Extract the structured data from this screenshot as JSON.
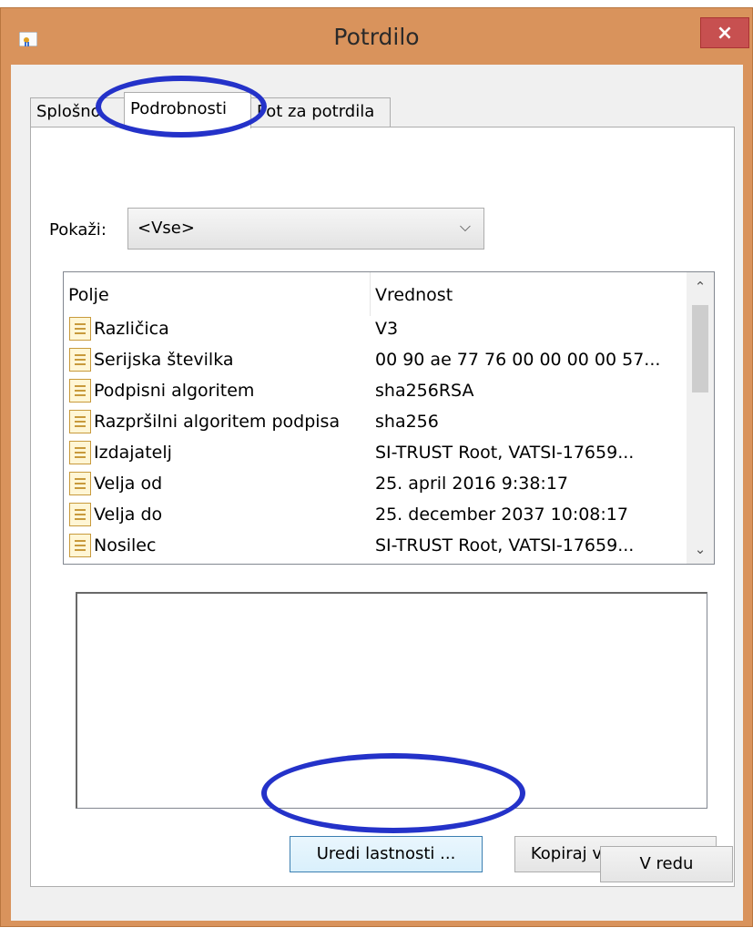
{
  "window": {
    "title": "Potrdilo",
    "close_label": "×"
  },
  "tabs": [
    {
      "label": "Splošno"
    },
    {
      "label": "Podrobnosti"
    },
    {
      "label": "Pot za potrdila"
    }
  ],
  "show": {
    "label": "Pokaži:",
    "value": "<Vse>"
  },
  "list": {
    "headers": {
      "field": "Polje",
      "value": "Vrednost"
    },
    "rows": [
      {
        "field": "Različica",
        "value": "V3"
      },
      {
        "field": "Serijska številka",
        "value": "00 90 ae 77 76 00 00 00 00 57..."
      },
      {
        "field": "Podpisni algoritem",
        "value": "sha256RSA"
      },
      {
        "field": "Razpršilni algoritem podpisa",
        "value": "sha256"
      },
      {
        "field": "Izdajatelj",
        "value": "SI-TRUST Root, VATSI-17659..."
      },
      {
        "field": "Velja od",
        "value": "25. april 2016 9:38:17"
      },
      {
        "field": "Velja do",
        "value": "25. december 2037 10:08:17"
      },
      {
        "field": "Nosilec",
        "value": "SI-TRUST Root, VATSI-17659..."
      }
    ]
  },
  "buttons": {
    "edit_properties": "Uredi lastnosti ...",
    "copy_to_file": "Kopiraj v datoteko ...",
    "ok": "V redu"
  },
  "colors": {
    "titlebar": "#d9935c",
    "close": "#c75050",
    "annotation": "#2432c9"
  },
  "icons": {
    "app": "certificate-icon",
    "row": "field-document-icon",
    "dropdown": "chevron-down-icon"
  }
}
